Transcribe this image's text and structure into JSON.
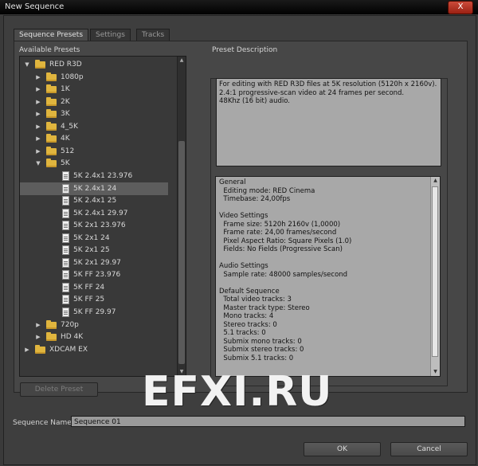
{
  "window": {
    "title": "New Sequence",
    "close_label": "X"
  },
  "tabs": [
    "Sequence Presets",
    "Settings",
    "Tracks"
  ],
  "available_presets_label": "Available Presets",
  "preset_description_label": "Preset Description",
  "tree": [
    {
      "label": "RED R3D",
      "level": 0,
      "type": "folder",
      "expanded": true
    },
    {
      "label": "1080p",
      "level": 1,
      "type": "folder"
    },
    {
      "label": "1K",
      "level": 1,
      "type": "folder"
    },
    {
      "label": "2K",
      "level": 1,
      "type": "folder"
    },
    {
      "label": "3K",
      "level": 1,
      "type": "folder"
    },
    {
      "label": "4_5K",
      "level": 1,
      "type": "folder"
    },
    {
      "label": "4K",
      "level": 1,
      "type": "folder"
    },
    {
      "label": "512",
      "level": 1,
      "type": "folder"
    },
    {
      "label": "5K",
      "level": 1,
      "type": "folder",
      "expanded": true
    },
    {
      "label": "5K 2.4x1 23.976",
      "level": 2,
      "type": "file"
    },
    {
      "label": "5K 2.4x1 24",
      "level": 2,
      "type": "file",
      "selected": true
    },
    {
      "label": "5K 2.4x1 25",
      "level": 2,
      "type": "file"
    },
    {
      "label": "5K 2.4x1 29.97",
      "level": 2,
      "type": "file"
    },
    {
      "label": "5K 2x1 23.976",
      "level": 2,
      "type": "file"
    },
    {
      "label": "5K 2x1 24",
      "level": 2,
      "type": "file"
    },
    {
      "label": "5K 2x1 25",
      "level": 2,
      "type": "file"
    },
    {
      "label": "5K 2x1 29.97",
      "level": 2,
      "type": "file"
    },
    {
      "label": "5K FF 23.976",
      "level": 2,
      "type": "file"
    },
    {
      "label": "5K FF 24",
      "level": 2,
      "type": "file"
    },
    {
      "label": "5K FF 25",
      "level": 2,
      "type": "file"
    },
    {
      "label": "5K FF 29.97",
      "level": 2,
      "type": "file"
    },
    {
      "label": "720p",
      "level": 1,
      "type": "folder"
    },
    {
      "label": "HD 4K",
      "level": 1,
      "type": "folder"
    },
    {
      "label": "XDCAM EX",
      "level": 0,
      "type": "folder"
    }
  ],
  "description_lines": [
    "For editing with RED R3D files at 5K resolution (5120h x 2160v).",
    "2.4:1 progressive-scan video at 24 frames per second.",
    "48Khz (16 bit) audio."
  ],
  "summary_lines": [
    "General",
    "  Editing mode: RED Cinema",
    "  Timebase: 24,00fps",
    "",
    "Video Settings",
    "  Frame size: 5120h 2160v (1,0000)",
    "  Frame rate: 24,00 frames/second",
    "  Pixel Aspect Ratio: Square Pixels (1.0)",
    "  Fields: No Fields (Progressive Scan)",
    "",
    "Audio Settings",
    "  Sample rate: 48000 samples/second",
    "",
    "Default Sequence",
    "  Total video tracks: 3",
    "  Master track type: Stereo",
    "  Mono tracks: 4",
    "  Stereo tracks: 0",
    "  5.1 tracks: 0",
    "  Submix mono tracks: 0",
    "  Submix stereo tracks: 0",
    "  Submix 5.1 tracks: 0"
  ],
  "delete_preset_label": "Delete Preset",
  "sequence_name_label": "Sequence Name:",
  "sequence_name_value": "Sequence 01",
  "ok_label": "OK",
  "cancel_label": "Cancel",
  "watermark_text": "EFXI.RU"
}
